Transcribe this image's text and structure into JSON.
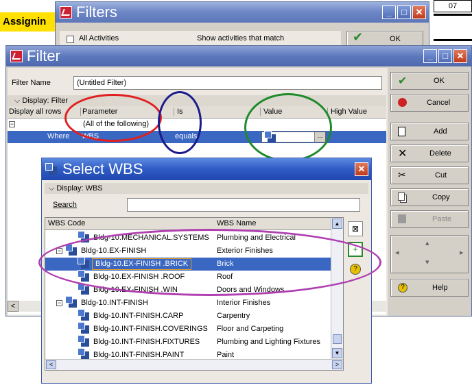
{
  "bg_window": {
    "label": "Assignin",
    "corner": "07"
  },
  "filters_window": {
    "title": "Filters",
    "all_activities": "All Activities",
    "show_match": "Show activities that match",
    "ok": "OK"
  },
  "filter_window": {
    "title": "Filter",
    "name_label": "Filter Name",
    "name_value": "(Untitled Filter)",
    "display_label": "Display: Filter",
    "columns": [
      "Display all rows",
      "Parameter",
      "Is",
      "Value",
      "High Value"
    ],
    "row1_param": "(All of the following)",
    "row2_where": "Where",
    "row2_param": "WBS",
    "row2_is": "equals",
    "buttons": {
      "ok": "OK",
      "cancel": "Cancel",
      "add": "Add",
      "delete": "Delete",
      "cut": "Cut",
      "copy": "Copy",
      "paste": "Paste",
      "help": "Help"
    }
  },
  "select_wbs": {
    "title": "Select WBS",
    "display_label": "Display: WBS",
    "search_label": "Search",
    "search_value": "",
    "col_code": "WBS Code",
    "col_name": "WBS Name",
    "rows": [
      {
        "code": "Bldg-10.MECHANICAL.SYSTEMS",
        "name": "Plumbing and Electrical"
      },
      {
        "code": "Bldg-10.EX-FINISH",
        "name": "Exterior Finishes"
      },
      {
        "code": "Bldg-10.EX-FINISH .BRICK",
        "name": "Brick"
      },
      {
        "code": "Bldg-10.EX-FINISH .ROOF",
        "name": "Roof"
      },
      {
        "code": "Bldg-10.EX-FINISH .WIN",
        "name": "Doors and Windows"
      },
      {
        "code": "Bldg-10.INT-FINISH",
        "name": "Interior Finishes"
      },
      {
        "code": "Bldg-10.INT-FINISH.CARP",
        "name": "Carpentry"
      },
      {
        "code": "Bldg-10.INT-FINISH.COVERINGS",
        "name": "Floor and Carpeting"
      },
      {
        "code": "Bldg-10.INT-FINISH.FIXTURES",
        "name": "Plumbing and Lighting Fixtures"
      },
      {
        "code": "Bldg-10.INT-FINISH.PAINT",
        "name": "Paint"
      }
    ]
  },
  "colors": {
    "selection": "#3a67c2",
    "red_circle": "#e02020",
    "blue_circle": "#1a1a8a",
    "green_circle": "#1f8a2c",
    "purple_circle": "#b040b0"
  }
}
